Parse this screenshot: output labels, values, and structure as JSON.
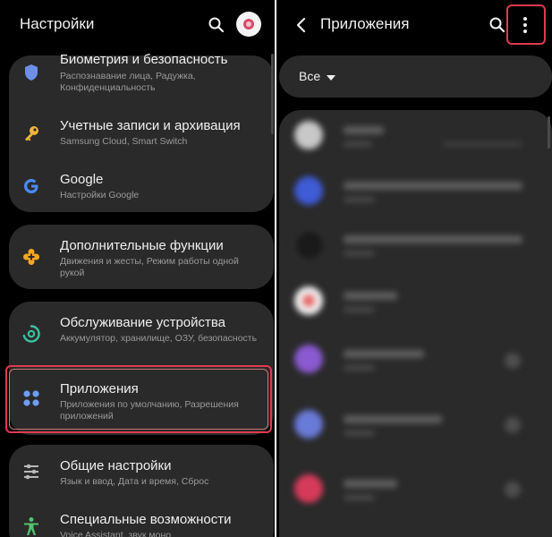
{
  "left": {
    "title": "Настройки",
    "items": [
      {
        "title": "Биометрия и безопасность",
        "subtitle": "Распознавание лица, Радужка, Конфиденциальность",
        "icon": "shield-icon",
        "color": "#6e8fe8"
      },
      {
        "title": "Учетные записи и архивация",
        "subtitle": "Samsung Cloud, Smart Switch",
        "icon": "key-icon",
        "color": "#f0b53a"
      },
      {
        "title": "Google",
        "subtitle": "Настройки Google",
        "icon": "google-icon",
        "color": "#4a8af4"
      },
      {
        "title": "Дополнительные функции",
        "subtitle": "Движения и жесты, Режим работы одной рукой",
        "icon": "plus-gear-icon",
        "color": "#f5a623"
      },
      {
        "title": "Обслуживание устройства",
        "subtitle": "Аккумулятор, хранилище, ОЗУ, безопасность",
        "icon": "device-care-icon",
        "color": "#39c2a0"
      },
      {
        "title": "Приложения",
        "subtitle": "Приложения по умолчанию, Разрешения приложений",
        "icon": "apps-icon",
        "color": "#6f9cf5"
      },
      {
        "title": "Общие настройки",
        "subtitle": "Язык и ввод, Дата и время, Сброс",
        "icon": "sliders-icon",
        "color": "#b8b8b8"
      },
      {
        "title": "Специальные возможности",
        "subtitle": "Voice Assistant, звук моно",
        "icon": "accessibility-icon",
        "color": "#52c26f"
      }
    ]
  },
  "right": {
    "title": "Приложения",
    "filter_label": "Все",
    "apps": [
      {
        "color": "#c8c8c8"
      },
      {
        "color": "#3f5bd6"
      },
      {
        "color": "#222222"
      },
      {
        "color": "#e86a6a"
      },
      {
        "color": "#8a5ad0"
      },
      {
        "color": "#6a7ad8"
      },
      {
        "color": "#d63a5a"
      }
    ]
  }
}
